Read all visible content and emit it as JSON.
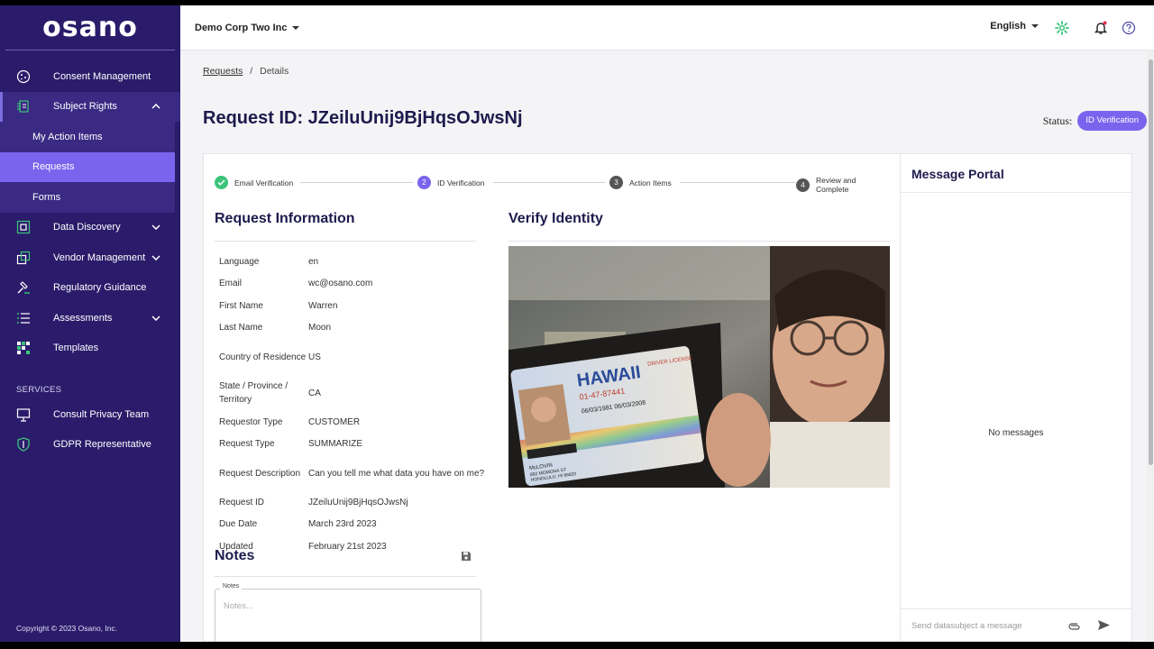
{
  "brand": {
    "logo_text": "osano",
    "copyright": "Copyright © 2023 Osano, Inc."
  },
  "sidebar": {
    "items": [
      {
        "label": "Consent Management",
        "icon": "cookie-icon"
      },
      {
        "label": "Subject Rights",
        "icon": "subject-rights-icon",
        "expanded": true,
        "children": [
          {
            "label": "My Action Items"
          },
          {
            "label": "Requests",
            "active": true
          },
          {
            "label": "Forms"
          }
        ]
      },
      {
        "label": "Data Discovery",
        "icon": "data-discovery-icon"
      },
      {
        "label": "Vendor Management",
        "icon": "vendor-icon"
      },
      {
        "label": "Regulatory Guidance",
        "icon": "gavel-icon"
      },
      {
        "label": "Assessments",
        "icon": "list-icon"
      },
      {
        "label": "Templates",
        "icon": "grid-icon"
      }
    ],
    "services_label": "SERVICES",
    "services": [
      {
        "label": "Consult Privacy Team",
        "icon": "monitor-icon"
      },
      {
        "label": "GDPR Representative",
        "icon": "shield-icon"
      }
    ]
  },
  "topbar": {
    "org_name": "Demo Corp Two Inc",
    "language": "English",
    "icons": [
      "settings-icon",
      "notification-bell-icon",
      "help-icon"
    ],
    "accent_color": "#3bc47a"
  },
  "breadcrumb": {
    "root": "Requests",
    "separator": "/",
    "current": "Details"
  },
  "page": {
    "title": "Request ID: JZeiluUnij9BjHqsOJwsNj",
    "status_label": "Status:",
    "status_value": "ID Verification"
  },
  "stepper": [
    {
      "label": "Email Verification",
      "state": "done"
    },
    {
      "label": "ID Verification",
      "number": "2",
      "state": "current"
    },
    {
      "label": "Action Items",
      "number": "3",
      "state": "todo"
    },
    {
      "label": "Review and Complete",
      "number": "4",
      "state": "todo"
    }
  ],
  "request_info": {
    "title": "Request Information",
    "rows": [
      {
        "k": "Language",
        "v": "en"
      },
      {
        "k": "Email",
        "v": "wc@osano.com"
      },
      {
        "k": "First Name",
        "v": "Warren"
      },
      {
        "k": "Last Name",
        "v": "Moon"
      },
      {
        "k": "Country of Residence",
        "v": "US"
      },
      {
        "k": "State / Province / Territory",
        "v": "CA"
      },
      {
        "k": "Requestor Type",
        "v": "CUSTOMER"
      },
      {
        "k": "Request Type",
        "v": "SUMMARIZE"
      },
      {
        "k": "Request Description",
        "v": "Can you tell me what data you have on me?"
      },
      {
        "k": "Request ID",
        "v": "JZeiluUnij9BjHqsOJwsNj"
      },
      {
        "k": "Due Date",
        "v": "March 23rd 2023"
      },
      {
        "k": "Updated",
        "v": "February 21st 2023"
      }
    ]
  },
  "verify": {
    "title": "Verify Identity",
    "id_card": {
      "state": "HAWAII",
      "sub": "DRIVER LICENSE",
      "number": "01-47-87441",
      "dates": "06/03/1981   06/03/2008",
      "name": "McLOVIN",
      "addr1": "892 MOMONA ST",
      "addr2": "HONOLULU, HI 96820"
    }
  },
  "notes": {
    "title": "Notes",
    "legend": "Notes",
    "placeholder": "Notes..."
  },
  "portal": {
    "title": "Message Portal",
    "empty": "No messages",
    "placeholder": "Send datasubject a message"
  },
  "colors": {
    "sidebar": "#2b1c6b",
    "accent": "#7a64ee",
    "success": "#3bc47a"
  }
}
